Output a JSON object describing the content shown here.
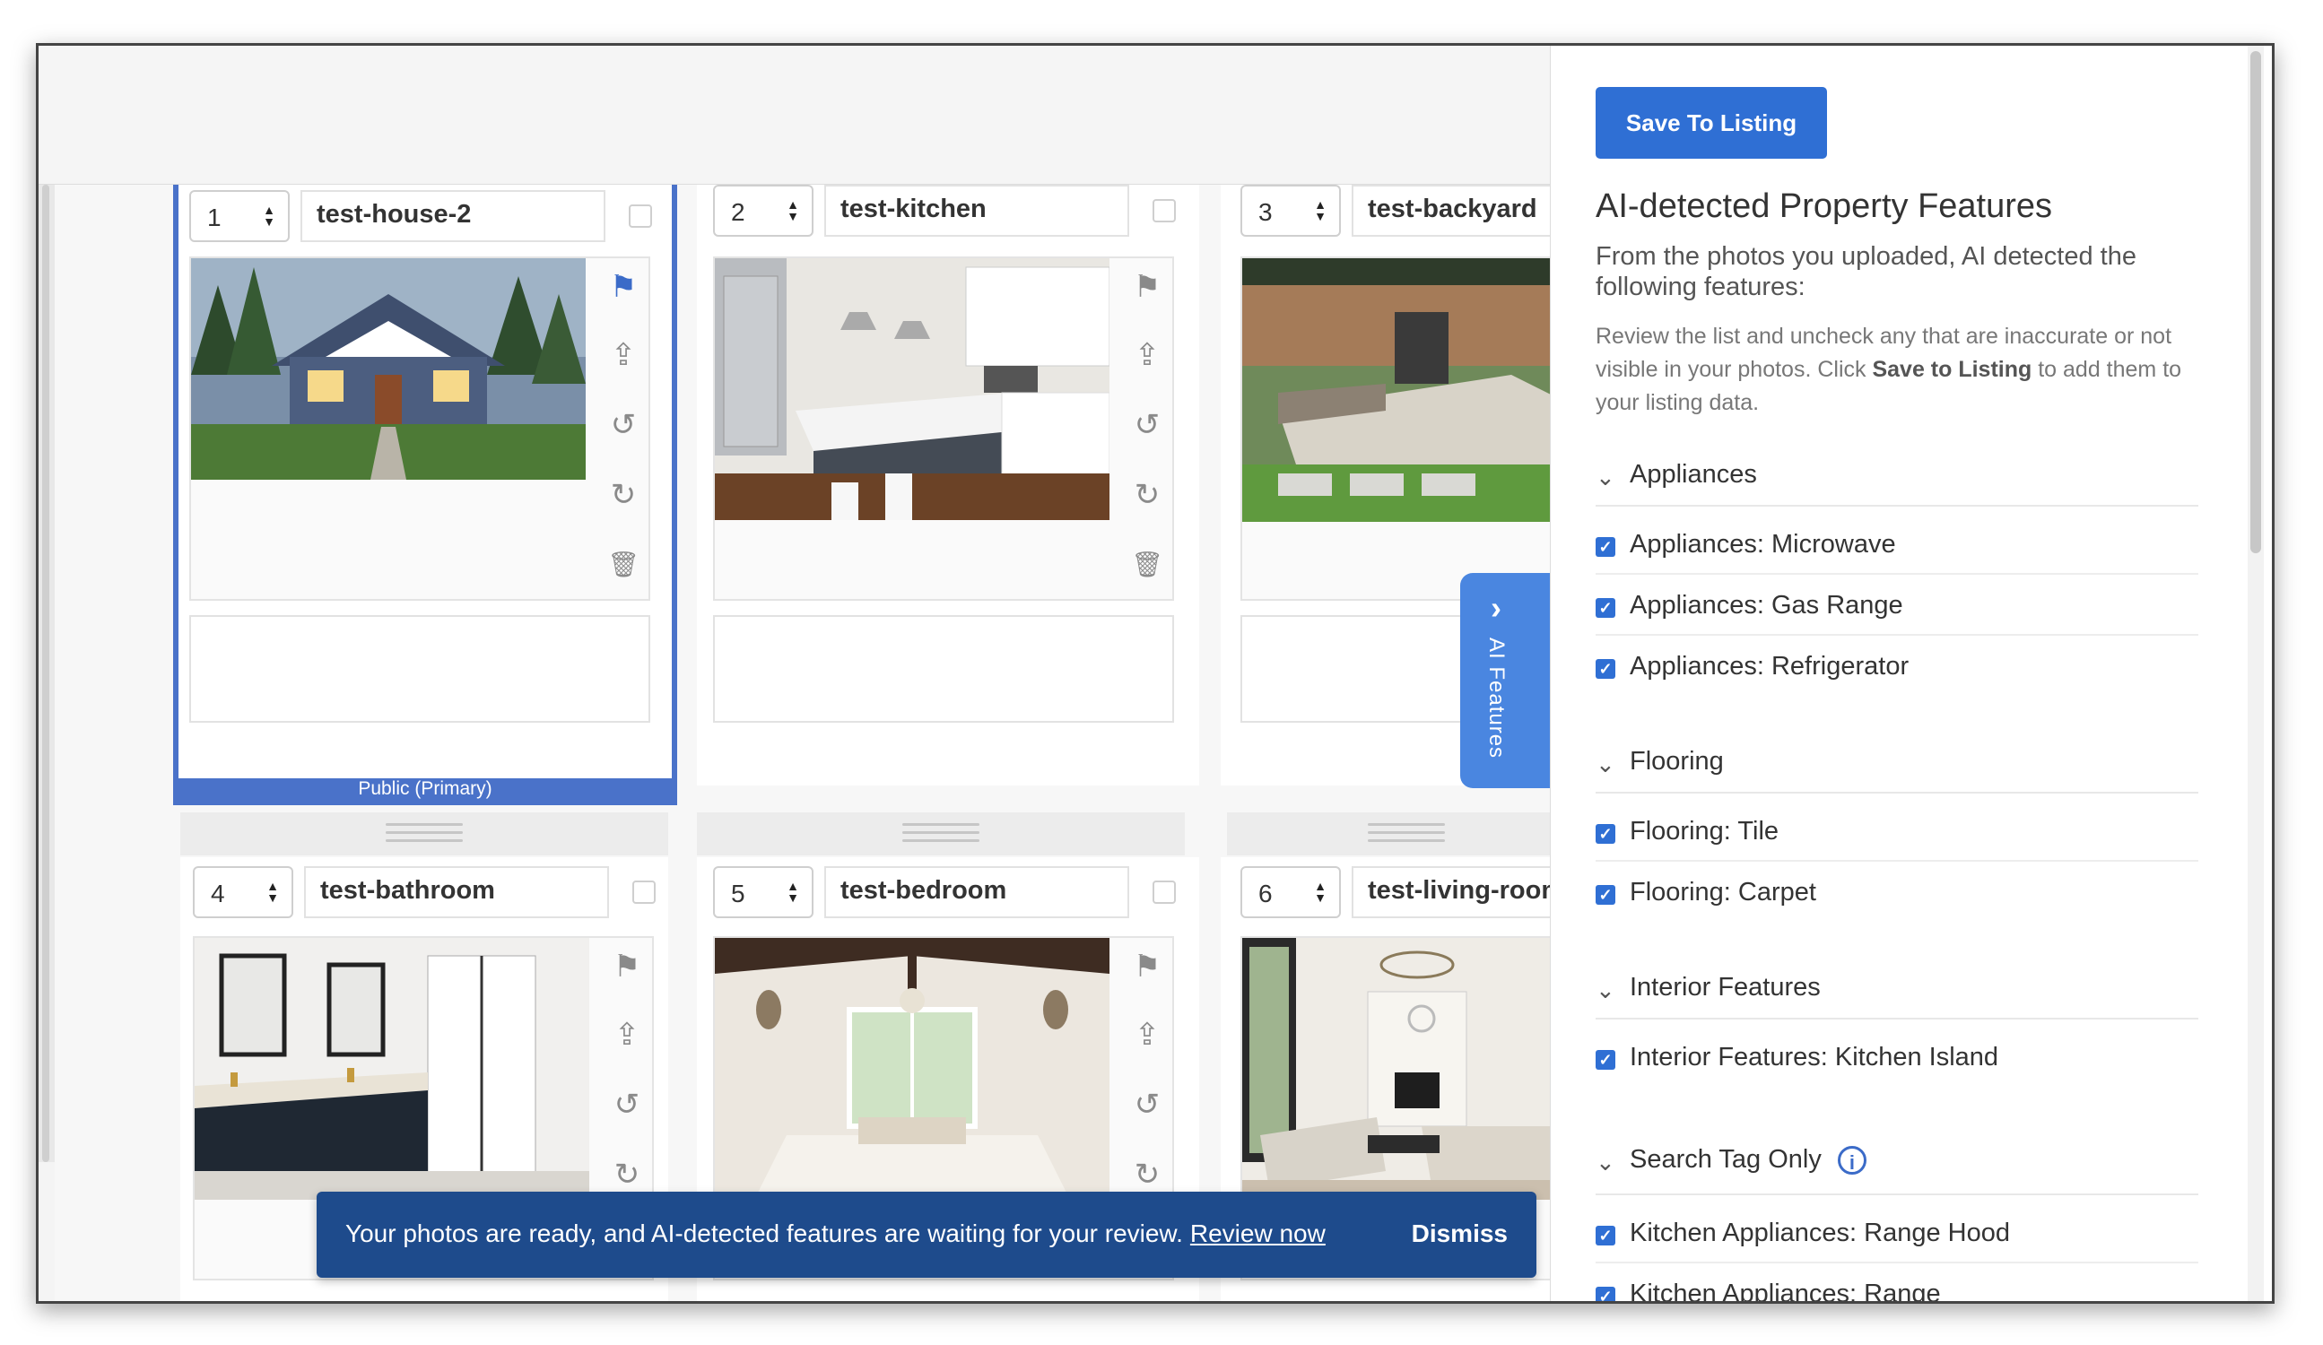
{
  "panel": {
    "save_button": "Save To Listing",
    "title": "AI-detected Property Features",
    "subtitle": "From the photos you uploaded, AI detected the following features:",
    "description_part1": "Review the list and uncheck any that are inaccurate or not visible in your photos. Click ",
    "description_bold": "Save to Listing",
    "description_part2": " to add them to your listing data.",
    "sections": [
      {
        "label": "Appliances",
        "items": [
          "Appliances: Microwave",
          "Appliances: Gas Range",
          "Appliances: Refrigerator"
        ]
      },
      {
        "label": "Flooring",
        "items": [
          "Flooring: Tile",
          "Flooring: Carpet"
        ]
      },
      {
        "label": "Interior Features",
        "items": [
          "Interior Features: Kitchen Island"
        ]
      },
      {
        "label": "Search Tag Only",
        "items": [
          "Kitchen Appliances: Range Hood",
          "Kitchen Appliances: Range"
        ]
      }
    ],
    "info_icon_glyph": "i"
  },
  "ai_tab": {
    "label": "AI Features",
    "arrow": "›"
  },
  "photos": [
    {
      "order": "1",
      "name": "test-house-2",
      "badge": "Public (Primary)"
    },
    {
      "order": "2",
      "name": "test-kitchen"
    },
    {
      "order": "3",
      "name": "test-backyard"
    },
    {
      "order": "4",
      "name": "test-bathroom"
    },
    {
      "order": "5",
      "name": "test-bedroom"
    },
    {
      "order": "6",
      "name": "test-living-room"
    }
  ],
  "toast": {
    "message": "Your photos are ready, and AI-detected features are waiting for your review.",
    "link": "Review now",
    "dismiss": "Dismiss"
  },
  "icons": {
    "flag": "flag-icon",
    "upload": "upload-icon",
    "rotate_left": "rotate-left-icon",
    "rotate_right": "rotate-right-icon",
    "trash": "trash-icon"
  },
  "colors": {
    "accent": "#2f6fd4",
    "primary_border": "#4a72c9",
    "toast_bg": "#1e4b8c"
  }
}
